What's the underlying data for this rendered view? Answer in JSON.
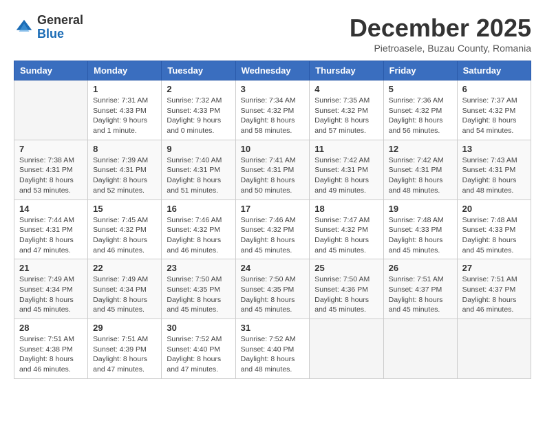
{
  "header": {
    "logo_general": "General",
    "logo_blue": "Blue",
    "month": "December 2025",
    "location": "Pietroasele, Buzau County, Romania"
  },
  "days_of_week": [
    "Sunday",
    "Monday",
    "Tuesday",
    "Wednesday",
    "Thursday",
    "Friday",
    "Saturday"
  ],
  "weeks": [
    [
      {
        "day": "",
        "info": ""
      },
      {
        "day": "1",
        "info": "Sunrise: 7:31 AM\nSunset: 4:33 PM\nDaylight: 9 hours\nand 1 minute."
      },
      {
        "day": "2",
        "info": "Sunrise: 7:32 AM\nSunset: 4:33 PM\nDaylight: 9 hours\nand 0 minutes."
      },
      {
        "day": "3",
        "info": "Sunrise: 7:34 AM\nSunset: 4:32 PM\nDaylight: 8 hours\nand 58 minutes."
      },
      {
        "day": "4",
        "info": "Sunrise: 7:35 AM\nSunset: 4:32 PM\nDaylight: 8 hours\nand 57 minutes."
      },
      {
        "day": "5",
        "info": "Sunrise: 7:36 AM\nSunset: 4:32 PM\nDaylight: 8 hours\nand 56 minutes."
      },
      {
        "day": "6",
        "info": "Sunrise: 7:37 AM\nSunset: 4:32 PM\nDaylight: 8 hours\nand 54 minutes."
      }
    ],
    [
      {
        "day": "7",
        "info": "Sunrise: 7:38 AM\nSunset: 4:31 PM\nDaylight: 8 hours\nand 53 minutes."
      },
      {
        "day": "8",
        "info": "Sunrise: 7:39 AM\nSunset: 4:31 PM\nDaylight: 8 hours\nand 52 minutes."
      },
      {
        "day": "9",
        "info": "Sunrise: 7:40 AM\nSunset: 4:31 PM\nDaylight: 8 hours\nand 51 minutes."
      },
      {
        "day": "10",
        "info": "Sunrise: 7:41 AM\nSunset: 4:31 PM\nDaylight: 8 hours\nand 50 minutes."
      },
      {
        "day": "11",
        "info": "Sunrise: 7:42 AM\nSunset: 4:31 PM\nDaylight: 8 hours\nand 49 minutes."
      },
      {
        "day": "12",
        "info": "Sunrise: 7:42 AM\nSunset: 4:31 PM\nDaylight: 8 hours\nand 48 minutes."
      },
      {
        "day": "13",
        "info": "Sunrise: 7:43 AM\nSunset: 4:31 PM\nDaylight: 8 hours\nand 48 minutes."
      }
    ],
    [
      {
        "day": "14",
        "info": "Sunrise: 7:44 AM\nSunset: 4:31 PM\nDaylight: 8 hours\nand 47 minutes."
      },
      {
        "day": "15",
        "info": "Sunrise: 7:45 AM\nSunset: 4:32 PM\nDaylight: 8 hours\nand 46 minutes."
      },
      {
        "day": "16",
        "info": "Sunrise: 7:46 AM\nSunset: 4:32 PM\nDaylight: 8 hours\nand 46 minutes."
      },
      {
        "day": "17",
        "info": "Sunrise: 7:46 AM\nSunset: 4:32 PM\nDaylight: 8 hours\nand 45 minutes."
      },
      {
        "day": "18",
        "info": "Sunrise: 7:47 AM\nSunset: 4:32 PM\nDaylight: 8 hours\nand 45 minutes."
      },
      {
        "day": "19",
        "info": "Sunrise: 7:48 AM\nSunset: 4:33 PM\nDaylight: 8 hours\nand 45 minutes."
      },
      {
        "day": "20",
        "info": "Sunrise: 7:48 AM\nSunset: 4:33 PM\nDaylight: 8 hours\nand 45 minutes."
      }
    ],
    [
      {
        "day": "21",
        "info": "Sunrise: 7:49 AM\nSunset: 4:34 PM\nDaylight: 8 hours\nand 45 minutes."
      },
      {
        "day": "22",
        "info": "Sunrise: 7:49 AM\nSunset: 4:34 PM\nDaylight: 8 hours\nand 45 minutes."
      },
      {
        "day": "23",
        "info": "Sunrise: 7:50 AM\nSunset: 4:35 PM\nDaylight: 8 hours\nand 45 minutes."
      },
      {
        "day": "24",
        "info": "Sunrise: 7:50 AM\nSunset: 4:35 PM\nDaylight: 8 hours\nand 45 minutes."
      },
      {
        "day": "25",
        "info": "Sunrise: 7:50 AM\nSunset: 4:36 PM\nDaylight: 8 hours\nand 45 minutes."
      },
      {
        "day": "26",
        "info": "Sunrise: 7:51 AM\nSunset: 4:37 PM\nDaylight: 8 hours\nand 45 minutes."
      },
      {
        "day": "27",
        "info": "Sunrise: 7:51 AM\nSunset: 4:37 PM\nDaylight: 8 hours\nand 46 minutes."
      }
    ],
    [
      {
        "day": "28",
        "info": "Sunrise: 7:51 AM\nSunset: 4:38 PM\nDaylight: 8 hours\nand 46 minutes."
      },
      {
        "day": "29",
        "info": "Sunrise: 7:51 AM\nSunset: 4:39 PM\nDaylight: 8 hours\nand 47 minutes."
      },
      {
        "day": "30",
        "info": "Sunrise: 7:52 AM\nSunset: 4:40 PM\nDaylight: 8 hours\nand 47 minutes."
      },
      {
        "day": "31",
        "info": "Sunrise: 7:52 AM\nSunset: 4:40 PM\nDaylight: 8 hours\nand 48 minutes."
      },
      {
        "day": "",
        "info": ""
      },
      {
        "day": "",
        "info": ""
      },
      {
        "day": "",
        "info": ""
      }
    ]
  ]
}
